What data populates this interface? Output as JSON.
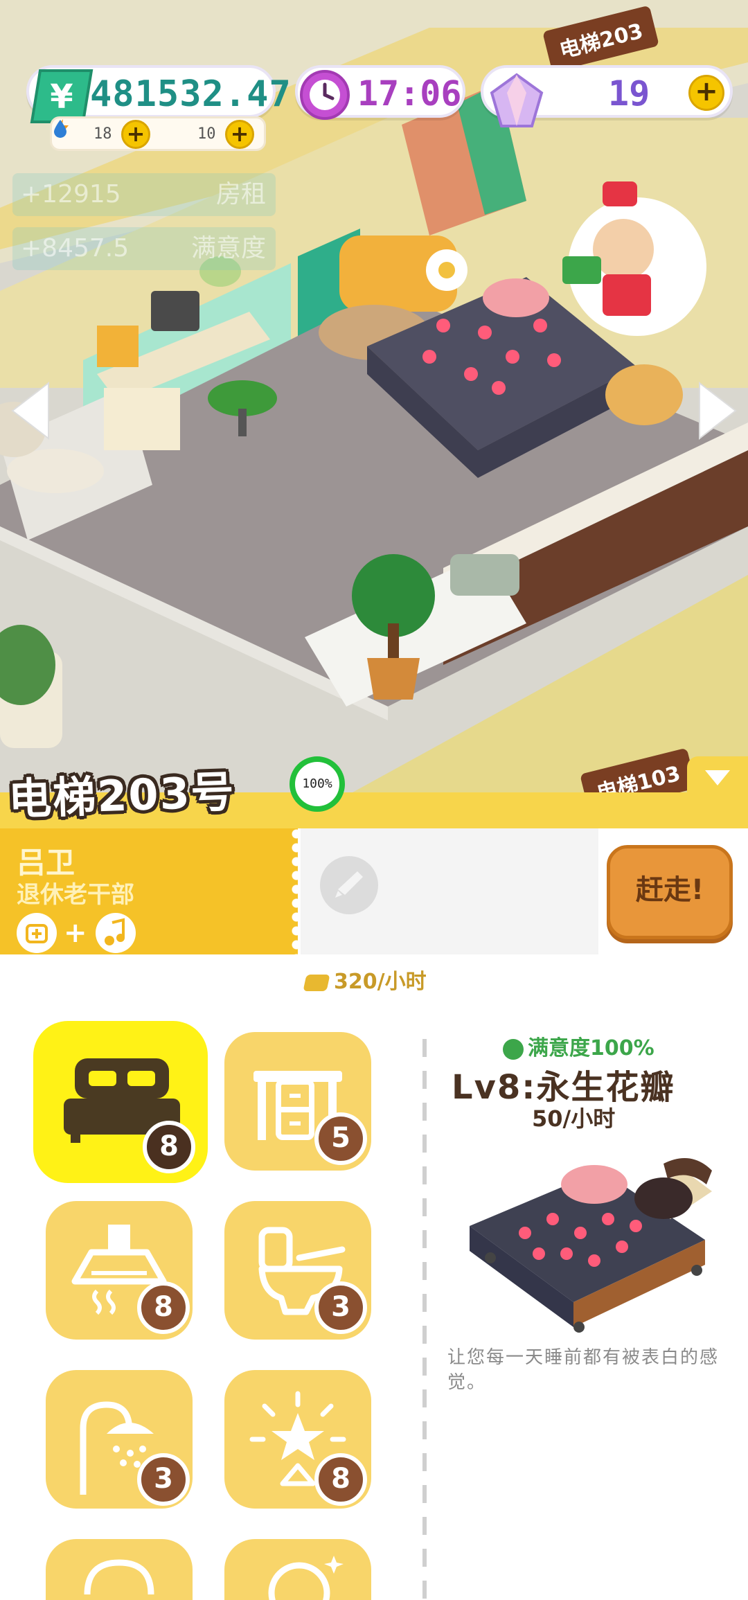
{
  "hud": {
    "money": "481532.47",
    "energy": "18",
    "water": "10",
    "time": "17:06",
    "gems": "19",
    "plus_symbol": "+",
    "icons": {
      "money": "yuan-icon",
      "clock": "clock-icon",
      "gem": "gem-icon",
      "energy": "lightning-icon",
      "water": "water-drop-icon"
    }
  },
  "ghost_rows": [
    {
      "value": "+12915",
      "label": "房租"
    },
    {
      "value": "+8457.5",
      "label": "满意度"
    }
  ],
  "elevator_tags": {
    "upper": "电梯203",
    "lower": "电梯103"
  },
  "room": {
    "title": "电梯203号",
    "satisfaction_pct": "100%"
  },
  "tenant": {
    "name": "吕卫",
    "role": "退休老干部",
    "trait_joiner": "+",
    "rent": "320/小时"
  },
  "evict_button": "赶走!",
  "categories": [
    {
      "id": "bed",
      "count": "8",
      "icon": "bed-icon",
      "selected": true
    },
    {
      "id": "desk",
      "count": "5",
      "icon": "desk-icon",
      "selected": false
    },
    {
      "id": "kitchen",
      "count": "8",
      "icon": "range-hood-icon",
      "selected": false
    },
    {
      "id": "toilet",
      "count": "3",
      "icon": "toilet-icon",
      "selected": false
    },
    {
      "id": "shower",
      "count": "3",
      "icon": "shower-icon",
      "selected": false
    },
    {
      "id": "decor",
      "count": "8",
      "icon": "star-lamp-icon",
      "selected": false
    }
  ],
  "item": {
    "satisfaction": "满意度100%",
    "name": "Lv8:永生花瓣",
    "rate": "50/小时",
    "description": "让您每一天睡前都有被表白的感觉。"
  },
  "colors": {
    "accent_yellow": "#f7d54b",
    "selected_tile": "#fff216",
    "money_green": "#1f8f85",
    "clock_purple": "#a83fbf",
    "gem_purple": "#7a55d0",
    "satisfaction_green": "#3ca64a"
  }
}
